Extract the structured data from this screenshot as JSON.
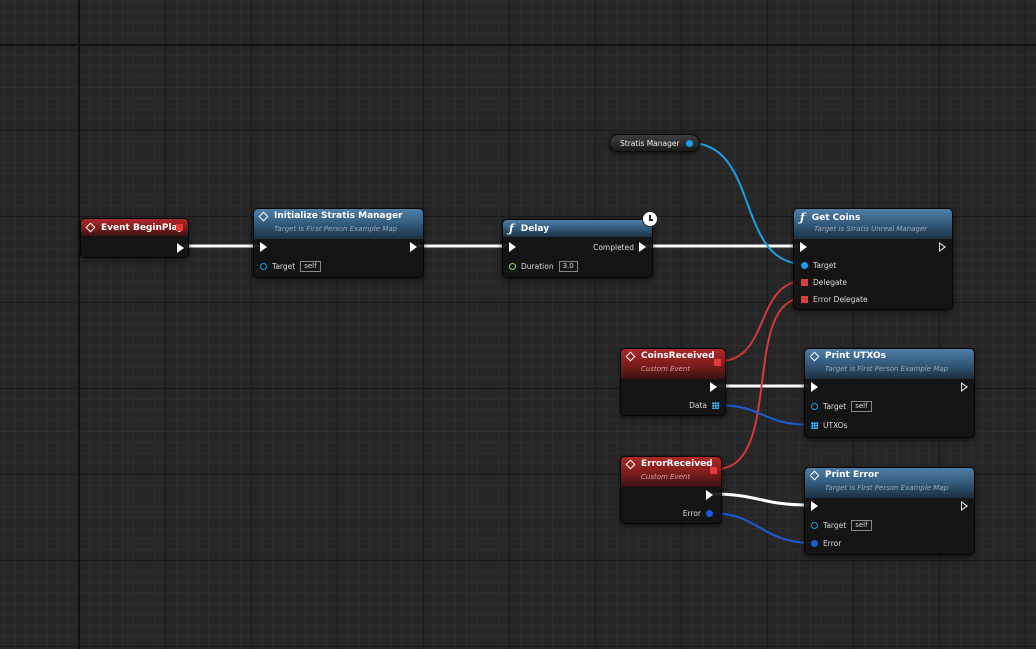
{
  "nodes": {
    "event_begin_play": {
      "title": "Event BeginPlay"
    },
    "initialize": {
      "title": "Initialize Stratis Manager",
      "subtitle": "Target is First Person Example Map",
      "target_label": "Target",
      "target_value": "self"
    },
    "delay": {
      "title": "Delay",
      "completed_label": "Completed",
      "duration_label": "Duration",
      "duration_value": "3.0"
    },
    "stratis_manager_var": {
      "label": "Stratis Manager"
    },
    "get_coins": {
      "title": "Get Coins",
      "subtitle": "Target is Stratis Unreal Manager",
      "target_label": "Target",
      "delegate_label": "Delegate",
      "error_delegate_label": "Error Delegate"
    },
    "coins_received": {
      "title": "CoinsReceived",
      "subtitle": "Custom Event",
      "data_label": "Data"
    },
    "print_utxos": {
      "title": "Print UTXOs",
      "subtitle": "Target is First Person Example Map",
      "target_label": "Target",
      "target_value": "self",
      "utxos_label": "UTXOs"
    },
    "error_received": {
      "title": "ErrorReceived",
      "subtitle": "Custom Event",
      "error_label": "Error"
    },
    "print_error": {
      "title": "Print Error",
      "subtitle": "Target is First Person Example Map",
      "target_label": "Target",
      "target_value": "self",
      "error_label": "Error"
    }
  },
  "colors": {
    "exec_wire": "#ffffff",
    "object_wire": "#1c9ee6",
    "delegate_wire": "#d03a3a",
    "struct_wire": "#1c5ad6",
    "event_header": "#8a1f1f",
    "function_header": "#3a6283",
    "grid_background": "#262626"
  }
}
